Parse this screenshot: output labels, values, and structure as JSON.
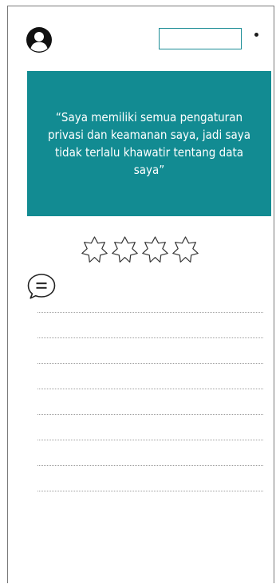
{
  "header": {
    "avatar_icon": "user-circle-icon",
    "input_value": "",
    "menu_icon": "dot-icon"
  },
  "quote": {
    "text": "“Saya memiliki semua pengaturan privasi dan keamanan saya, jadi saya tidak terlalu khawatir tentang data saya”",
    "background_color": "#128b92",
    "text_color": "#ffffff"
  },
  "rating": {
    "value": 0,
    "max": 4,
    "star_icon": "star-outline-icon"
  },
  "comment": {
    "icon": "comment-icon",
    "line_count": 8
  }
}
